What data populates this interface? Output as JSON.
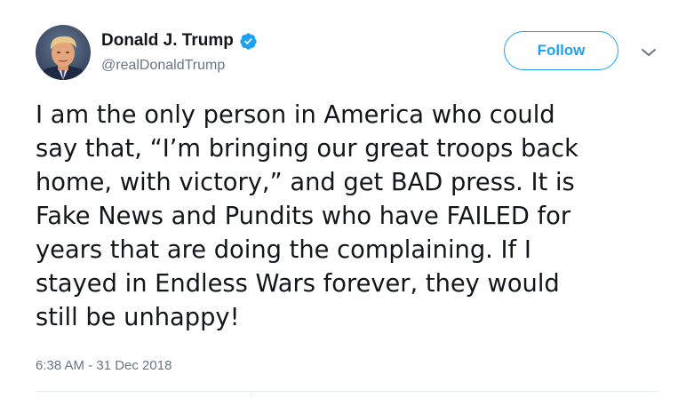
{
  "author": {
    "display_name": "Donald J. Trump",
    "handle": "@realDonaldTrump",
    "verified": true,
    "avatar_icon": "profile-photo"
  },
  "actions": {
    "follow_label": "Follow",
    "menu_icon": "chevron-down-icon"
  },
  "tweet": {
    "lines": [
      "I am the only person in America who could",
      "say that, “I’m bringing our great troops back",
      "home, with victory,” and get BAD press. It is",
      "Fake News and Pundits who have FAILED for",
      "years that are doing the complaining. If I",
      "stayed in Endless Wars forever, they would",
      "still be unhappy!"
    ],
    "timestamp": "6:38 AM - 31 Dec 2018"
  },
  "colors": {
    "accent": "#1da1f2",
    "text_primary": "#14171a",
    "text_secondary": "#657786",
    "divider": "#e6ecf0"
  }
}
